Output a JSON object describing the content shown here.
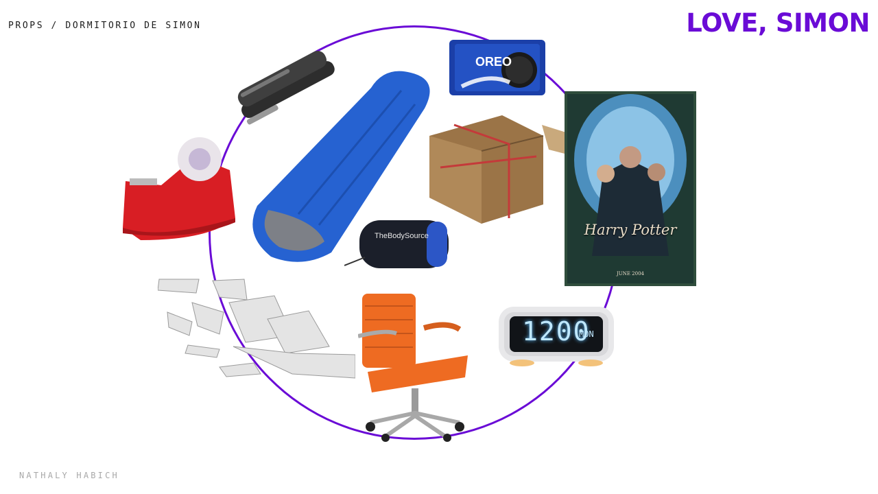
{
  "header": {
    "section_label": "PROPS / DORMITORIO DE SIMON",
    "title": "LOVE, SIMON"
  },
  "footer": {
    "author": "NATHALY HABICH"
  },
  "colors": {
    "accent": "#6a0bd6",
    "author_gray": "#a8a8a8"
  },
  "props": {
    "stapler": {
      "icon": "stapler-icon"
    },
    "tape": {
      "icon": "tape-dispenser-icon"
    },
    "sleeping_bag": {
      "icon": "sleeping-bag-icon",
      "stuff_sack_brand": "TheBodySource"
    },
    "oreo": {
      "icon": "cookie-pack-icon",
      "brand": "OREO"
    },
    "gift": {
      "icon": "gift-box-icon"
    },
    "poster": {
      "icon": "movie-poster-icon",
      "title_line1": "Harry Potter",
      "date": "JUNE 2004"
    },
    "papers": {
      "icon": "flying-papers-icon"
    },
    "chair": {
      "icon": "office-chair-icon"
    },
    "clock": {
      "icon": "alarm-clock-icon",
      "time": "1200",
      "day": "MON"
    }
  }
}
